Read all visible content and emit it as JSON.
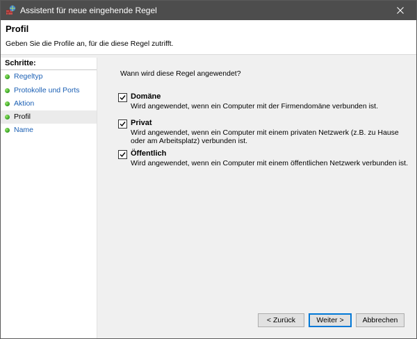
{
  "window": {
    "title": "Assistent für neue eingehende Regel",
    "close_icon": "close-icon"
  },
  "header": {
    "title": "Profil",
    "description": "Geben Sie die Profile an, für die diese Regel zutrifft."
  },
  "steps": {
    "heading": "Schritte:",
    "items": [
      {
        "label": "Regeltyp",
        "current": false
      },
      {
        "label": "Protokolle und Ports",
        "current": false
      },
      {
        "label": "Aktion",
        "current": false
      },
      {
        "label": "Profil",
        "current": true
      },
      {
        "label": "Name",
        "current": false
      }
    ]
  },
  "main": {
    "question": "Wann wird diese Regel angewendet?",
    "options": [
      {
        "label": "Domäne",
        "checked": true,
        "description": "Wird angewendet, wenn ein Computer mit der Firmendomäne verbunden ist."
      },
      {
        "label": "Privat",
        "checked": true,
        "description_line1": "Wird angewendet, wenn ein Computer mit einem privaten Netzwerk (z.B. zu Hause",
        "description_line2": "oder am Arbeitsplatz) verbunden ist."
      },
      {
        "label": "Öffentlich",
        "checked": true,
        "description": "Wird angewendet, wenn ein Computer mit einem öffentlichen Netzwerk verbunden ist."
      }
    ]
  },
  "buttons": {
    "back": "< Zurück",
    "next": "Weiter >",
    "cancel": "Abbrechen"
  },
  "colors": {
    "titlebar": "#4d4d4d",
    "link": "#1a5fb4",
    "step_dot": "#2f9d1f",
    "primary_border": "#0078d7"
  }
}
